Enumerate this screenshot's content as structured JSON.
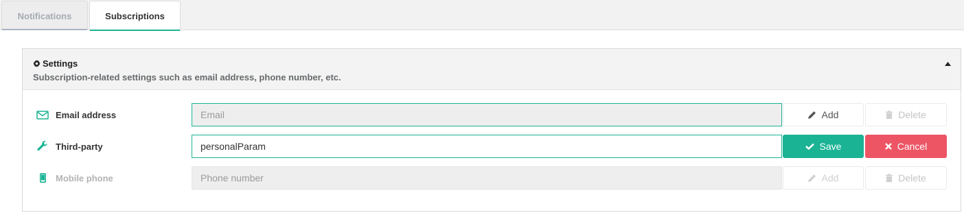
{
  "tabs": [
    {
      "label": "Notifications",
      "active": false
    },
    {
      "label": "Subscriptions",
      "active": true
    }
  ],
  "panel": {
    "title": "Settings",
    "subtitle": "Subscription-related settings such as email address, phone number, etc.",
    "icons": {
      "title": "gear-icon",
      "collapse": "caret-up-icon"
    }
  },
  "rows": {
    "email": {
      "label": "Email address",
      "icon": "envelope-icon",
      "placeholder": "Email",
      "value": "",
      "add_label": "Add",
      "delete_label": "Delete"
    },
    "thirdparty": {
      "label": "Third-party",
      "icon": "wrench-icon",
      "value": "personalParam",
      "save_label": "Save",
      "cancel_label": "Cancel"
    },
    "mobile": {
      "label": "Mobile phone",
      "icon": "mobile-icon",
      "placeholder": "Phone number",
      "value": "",
      "add_label": "Add",
      "delete_label": "Delete"
    }
  },
  "colors": {
    "accent": "#1ab394",
    "danger": "#ed5565"
  }
}
